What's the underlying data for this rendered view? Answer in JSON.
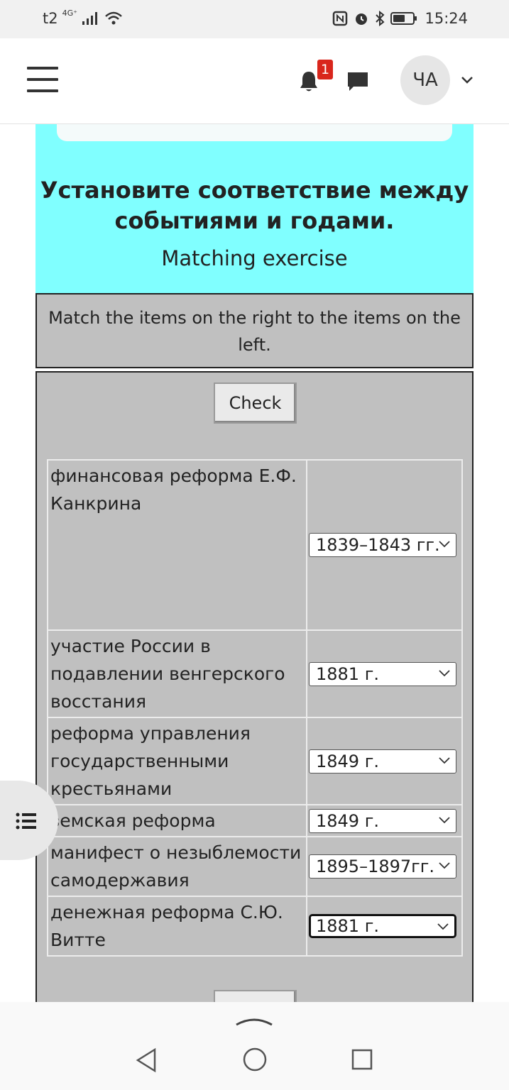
{
  "status_bar": {
    "carrier": "t2",
    "network": "4G⁺",
    "time": "15:24"
  },
  "header": {
    "notification_count": "1",
    "avatar_initials": "ЧА"
  },
  "quiz": {
    "title": "Установите соответствие между событиями и годами.",
    "subtitle": "Matching exercise",
    "instructions": "Match the items on the right to the items on the left.",
    "check_label": "Check",
    "rows": [
      {
        "question": "финансовая реформа Е.Ф. Канкрина",
        "answer": "1839–1843 гг."
      },
      {
        "question": "участие России в подавлении венгерского восстания",
        "answer": "1881 г."
      },
      {
        "question": "реформа управления государственными крестьянами",
        "answer": "1849 г."
      },
      {
        "question": "земская реформа",
        "answer": "1849 г."
      },
      {
        "question": "манифест о незыблемости самодержавия",
        "answer": "1895–1897гг."
      },
      {
        "question": "денежная реформа С.Ю. Витте",
        "answer": "1881 г."
      }
    ]
  },
  "icons": {
    "menu": "hamburger-icon",
    "notifications": "bell-icon",
    "messages": "chat-icon",
    "toc": "list-icon",
    "nav_back": "back-triangle-icon",
    "nav_home": "home-circle-icon",
    "nav_recent": "recent-square-icon"
  },
  "colors": {
    "accent_cyan": "#80ffff",
    "panel_gray": "#c0c0c0",
    "badge_red": "#d9261c"
  }
}
